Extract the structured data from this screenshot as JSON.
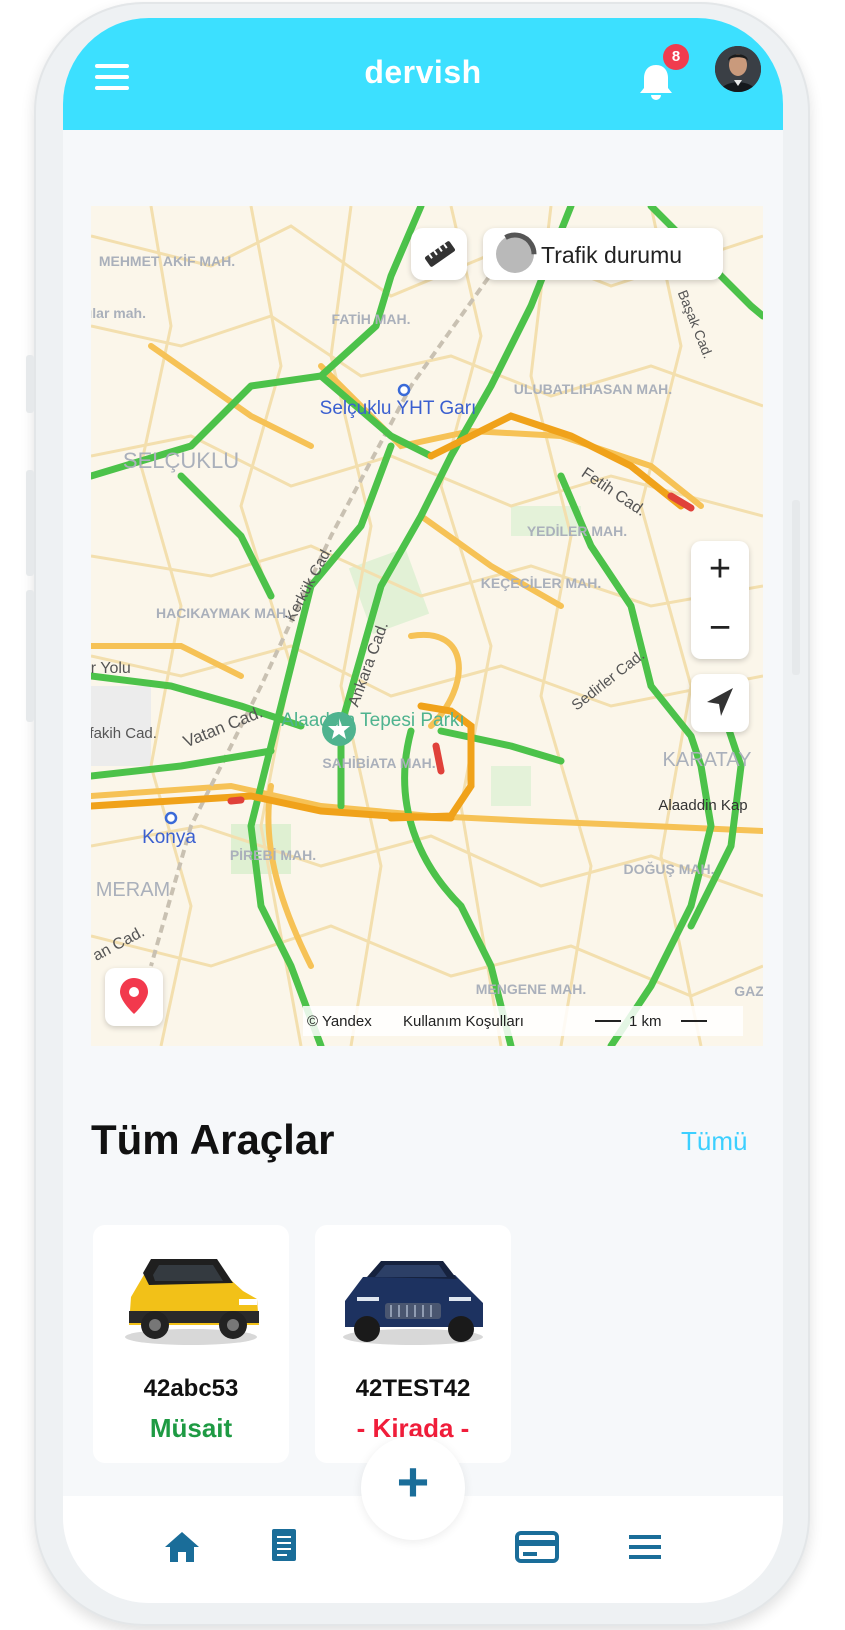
{
  "app": {
    "brand": "dervish",
    "notification_count": "8",
    "accent": "#3ce0ff"
  },
  "header": {
    "menu_icon": "hamburger-icon",
    "bell_icon": "bell-icon",
    "avatar": "user-avatar"
  },
  "map": {
    "traffic_label": "Trafik durumu",
    "ruler_icon": "ruler-icon",
    "zoom_in": "+",
    "zoom_out": "−",
    "locate_icon": "navigation-arrow-icon",
    "pin_icon": "map-pin-icon",
    "attribution": {
      "copyright": "© Yandex",
      "terms": "Kullanım Koşulları",
      "scale": "1 km"
    },
    "labels": [
      "MEHMET AKİF MAH.",
      "FATİH MAH.",
      "Selçuklu YHT Garı",
      "ULUBATLIHASAN MAH.",
      "SELÇUKLU",
      "Fetih Cad.",
      "Başak Cad.",
      "Kerkük Cad.",
      "YEDİLER MAH.",
      "Ankara Cad.",
      "KEÇECİLER MAH.",
      "HACIKAYMAK MAH.",
      "Sedirler Cad.",
      "Vatan Cad.",
      "Alaaddin Tepesi Parkı",
      "SAHİBİATA MAH.",
      "KARATAY",
      "Alaaddin Kap",
      "Konya",
      "PİREBİ MAH.",
      "DOĞUŞ MAH.",
      "MERAM",
      "MENGENE MAH.",
      "GAZİ",
      "ncılar mah.",
      "afakih Cad.",
      "ir Yolu",
      "an Cad."
    ]
  },
  "vehicles": {
    "title": "Tüm Araçlar",
    "see_all": "Tümü",
    "items": [
      {
        "plate": "42abc53",
        "status": "Müsait",
        "status_color": "#1e9a43"
      },
      {
        "plate": "42TEST42",
        "status": "- Kirada -",
        "status_color": "#f01d3a"
      }
    ]
  },
  "bottom_nav": {
    "items": [
      "home-icon",
      "document-icon",
      "card-icon",
      "menu-icon"
    ],
    "fab": "+",
    "icon_color": "#1a6d99"
  }
}
